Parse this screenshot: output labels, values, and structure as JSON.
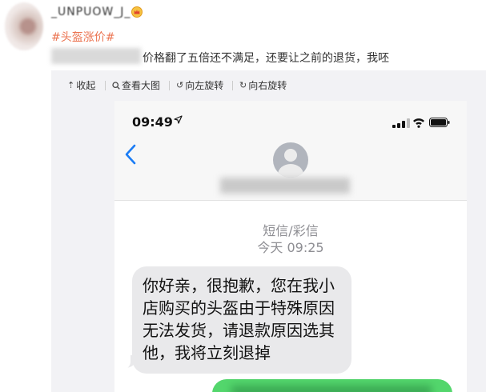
{
  "post": {
    "username": "_UNPUOW_J_",
    "hashtag": "#头盔涨价#",
    "text": "价格翻了五倍还不满足，还要让之前的退货，我呸"
  },
  "toolbar": {
    "collapse": "收起",
    "view_large": "查看大图",
    "rotate_left": "向左旋转",
    "rotate_right": "向右旋转"
  },
  "phone": {
    "status_time": "09:49",
    "sms_label": "短信/彩信",
    "sms_time": "今天 09:25",
    "message": "你好亲，很抱歉，您在我小店购买的头盔由于特殊原因无法发货，请退款原因选其他，我将立刻退掉"
  },
  "colors": {
    "hashtag": "#eb7350",
    "bubble_gray": "#e9e9eb",
    "bubble_green": "#53d66c",
    "ios_blue": "#1a7cf5"
  }
}
